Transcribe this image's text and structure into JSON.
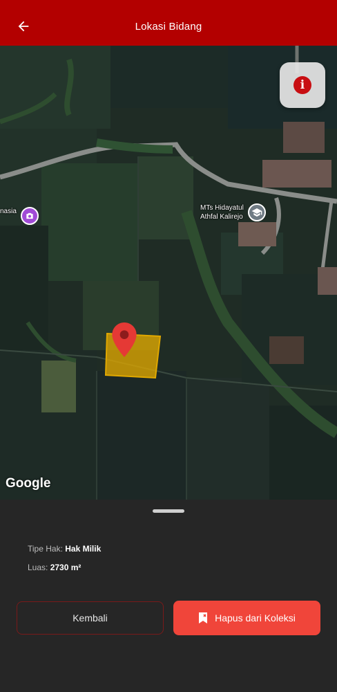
{
  "appbar": {
    "title": "Lokasi Bidang",
    "back_icon": "arrow-left-icon"
  },
  "map": {
    "info_icon": "info-icon",
    "pois": [
      {
        "label": "nasia",
        "icon": "camera-icon",
        "color": "#a04bd6"
      },
      {
        "label_line1": "MTs Hidayatul",
        "label_line2": "Athfal Kalirejo",
        "icon": "school-icon",
        "color": "#6f7b84"
      }
    ],
    "marker_icon": "location-pin-icon",
    "parcel_color": "#e0a800",
    "attribution": "Google"
  },
  "details": {
    "tipe_hak_label": "Tipe Hak:",
    "tipe_hak_value": "Hak Milik",
    "luas_label": "Luas:",
    "luas_value": "2730 m²"
  },
  "actions": {
    "back_label": "Kembali",
    "remove_label": "Hapus dari Koleksi",
    "remove_icon": "bookmark-remove-icon"
  },
  "colors": {
    "appbar": "#b30000",
    "accent": "#f0453a",
    "sheet": "#262626"
  }
}
